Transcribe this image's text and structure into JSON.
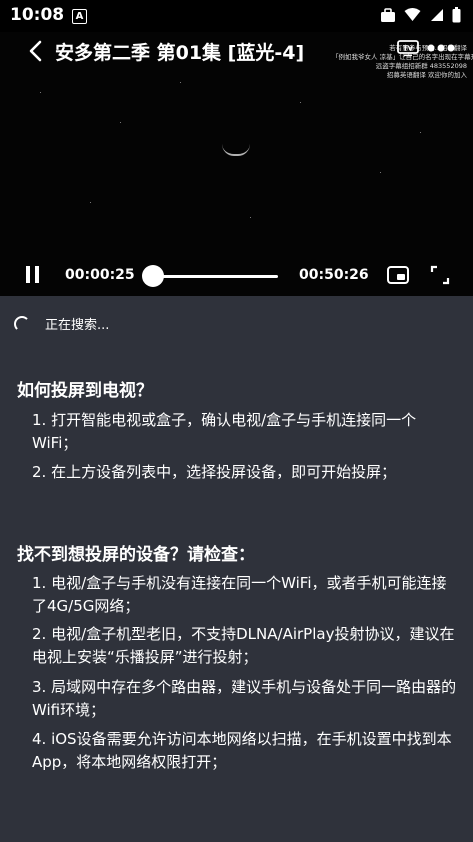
{
  "status_bar": {
    "time": "10:08",
    "badge": "A"
  },
  "video": {
    "title": "安多第二季 第01集 [蓝光-4]",
    "notice_lines": [
      "若有意参与预约...招募翻译",
      "「例如我爷女人 凉基」让自己的名字出现在字幕开头",
      "远盗字幕组招新群 483552098",
      "招募英语翻译 欢迎你的加入"
    ]
  },
  "player": {
    "current_time": "00:00:25",
    "total_time": "00:50:26",
    "progress": 0.0083
  },
  "cast": {
    "searching_text": "正在搜索...",
    "how_title": "如何投屏到电视？",
    "how_items": [
      "1. 打开智能电视或盒子，确认电视/盒子与手机连接同一个WiFi；",
      "2. 在上方设备列表中，选择投屏设备，即可开始投屏；"
    ],
    "trouble_title": "找不到想投屏的设备？请检查：",
    "trouble_items": [
      "1. 电视/盒子与手机没有连接在同一个WiFi，或者手机可能连接了4G/5G网络；",
      "2. 电视/盒子机型老旧，不支持DLNA/AirPlay投射协议，建议在电视上安装“乐播投屏”进行投射；",
      "3. 局域网中存在多个路由器，建议手机与设备处于同一路由器的Wifi环境；",
      "4. iOS设备需要允许访问本地网络以扫描，在手机设置中找到本App，将本地网络权限打开；"
    ]
  }
}
